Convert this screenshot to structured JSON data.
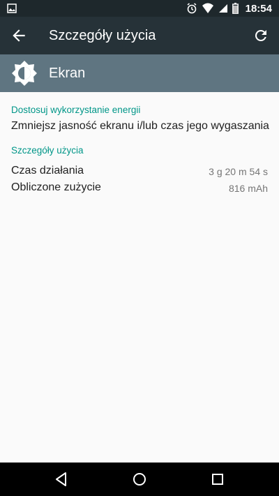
{
  "status_bar": {
    "time": "18:54",
    "icons": [
      "image-notification-icon",
      "alarm-icon",
      "wifi-icon",
      "signal-icon",
      "battery-icon"
    ],
    "background": "#1e282c"
  },
  "app_bar": {
    "title": "Szczegóły użycia",
    "back_icon": "arrow-back-icon",
    "refresh_icon": "refresh-icon",
    "background": "#263238"
  },
  "header": {
    "label": "Ekran",
    "icon": "brightness-icon",
    "background": "#5f7581"
  },
  "sections": {
    "energy": {
      "title": "Dostosuj wykorzystanie energii",
      "item": "Zmniejsz jasność ekranu i/lub czas jego wygaszania"
    },
    "details": {
      "title": "Szczegóły użycia",
      "rows": [
        {
          "label": "Czas działania",
          "value": "3 g 20 m 54 s"
        },
        {
          "label": "Obliczone zużycie",
          "value": "816 mAh"
        }
      ]
    }
  },
  "colors": {
    "accent": "#009688",
    "secondary_text": "#757575"
  },
  "nav_bar": {
    "buttons": [
      "back-triangle-icon",
      "home-circle-icon",
      "recents-square-icon"
    ]
  }
}
